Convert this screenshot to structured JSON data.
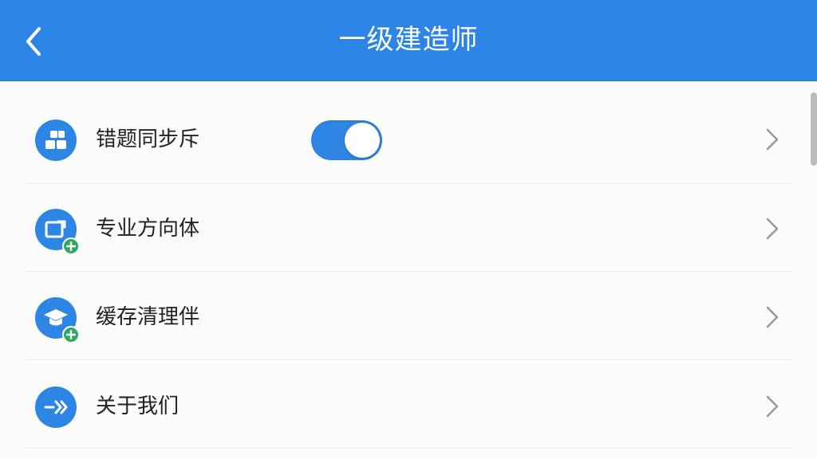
{
  "header": {
    "title": "一级建造师",
    "back_icon": "chevron-left-icon",
    "color": "#2b84e6"
  },
  "settings": {
    "items": [
      {
        "label": "错题同步斥",
        "icon": "grid-icon",
        "has_toggle": true,
        "toggle_on": true
      },
      {
        "label": "专业方向体",
        "icon": "export-add-icon",
        "badge": "plus-icon"
      },
      {
        "label": "缓存清理伴",
        "icon": "graduation-cap-icon",
        "badge": "plus-icon"
      },
      {
        "label": "关于我们",
        "icon": "signal-arrow-icon"
      }
    ],
    "chevron_icon": "chevron-right-icon"
  },
  "colors": {
    "accent": "#2e86e4",
    "badge": "#2eaa5c",
    "text": "#222222"
  }
}
